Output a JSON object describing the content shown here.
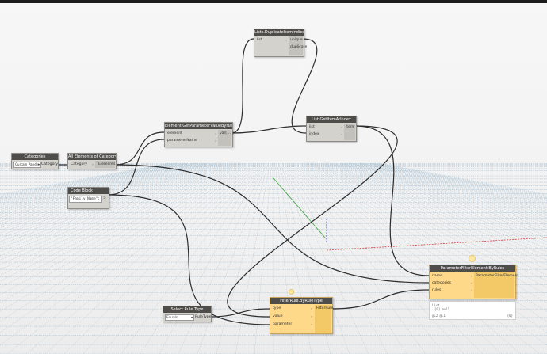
{
  "nodes": {
    "categories": {
      "title": "Categories",
      "dropdown": "Curtain Panels",
      "output": "Category"
    },
    "all_elements": {
      "title": "All Elements of Category",
      "input": "Category",
      "output": "Elements"
    },
    "code_block": {
      "title": "Code Block",
      "code": "\"Family Name\";",
      "output": ">"
    },
    "get_param": {
      "title": "Element.GetParameterValueByName",
      "inputs": [
        "element",
        "parameterName"
      ],
      "output": "var[]..[]"
    },
    "dup_indices": {
      "title": "Lists.DuplicateItemIndices",
      "input": "list",
      "outputs": [
        "unique",
        "duplicate"
      ]
    },
    "get_item": {
      "title": "List.GetItemAtIndex",
      "inputs": [
        "list",
        "index"
      ],
      "output": "item"
    },
    "select_rule": {
      "title": "Select Rule Type",
      "dropdown": "Equals",
      "output": "RuleType"
    },
    "filter_rule": {
      "title": "FilterRule.ByRuleType",
      "inputs": [
        "type",
        "value",
        "parameter"
      ],
      "output": "FilterRule"
    },
    "param_filter": {
      "title": "ParameterFilterElement.ByRules",
      "inputs": [
        "name",
        "categories",
        "rules"
      ],
      "output": "ParameterFilterElement"
    }
  },
  "preview": {
    "line1": "List",
    "line2": "[0] null",
    "footer_left": "@L2 @L1",
    "footer_right": "{0}"
  },
  "icons": [
    "dropdown-arrow-icon",
    "lightbulb-icon",
    "port-chevron-icon"
  ]
}
